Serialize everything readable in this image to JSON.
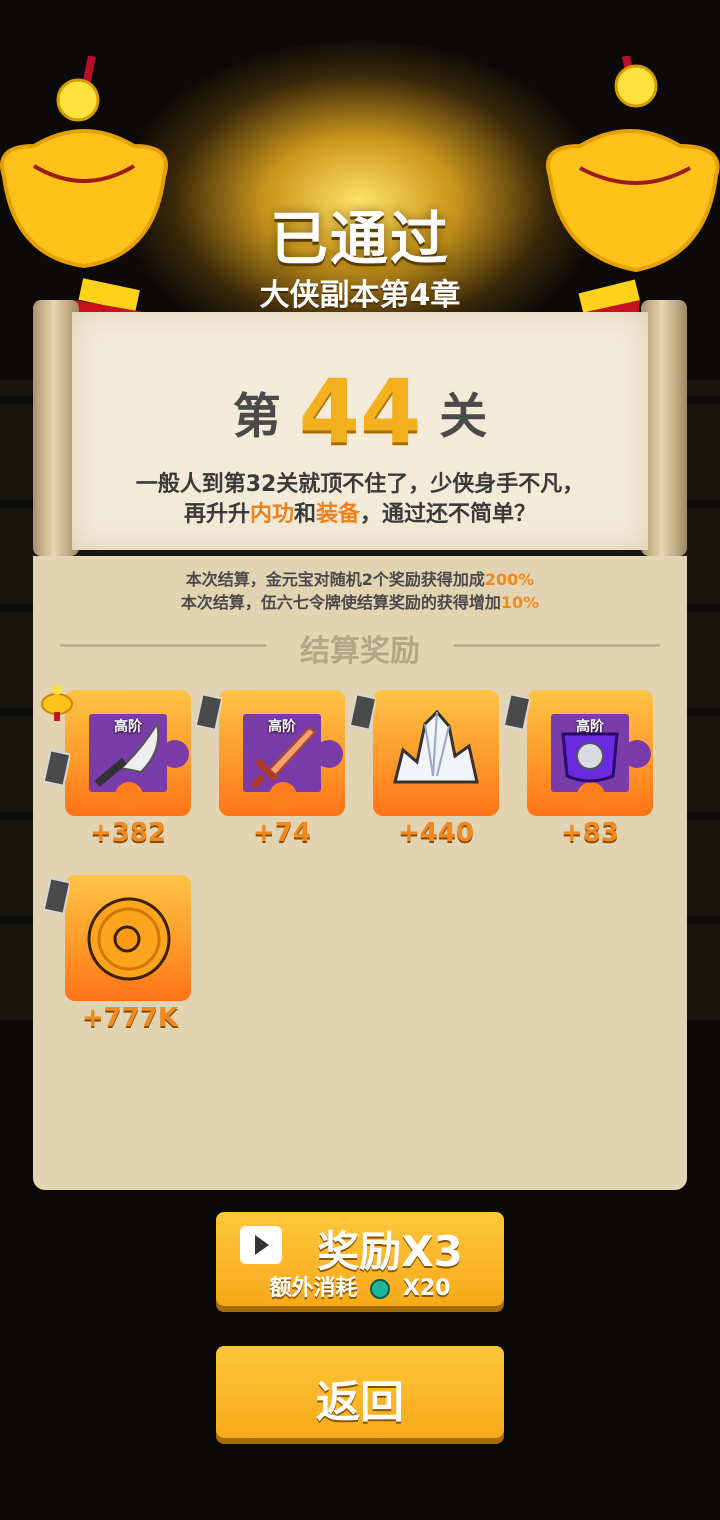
{
  "header": {
    "title": "已通过",
    "chapter": "大侠副本第4章"
  },
  "level": {
    "prefix": "第",
    "number": "44",
    "suffix": "关"
  },
  "description": {
    "line1": "一般人到第32关就顶不住了，少侠身手不凡，",
    "line2_a": "再升升",
    "line2_h1": "内功",
    "line2_b": "和",
    "line2_h2": "装备",
    "line2_c": "，通过还不简单？"
  },
  "bonus_notes": {
    "note1_text": "本次结算，金元宝对随机2个奖励获得加成",
    "note1_percent": "200%",
    "note2_text": "本次结算，伍六七令牌使结算奖励的获得增加",
    "note2_percent": "10%"
  },
  "rewards_section": {
    "title": "结算奖励",
    "items": [
      {
        "icon": "broadsword-fragment-icon",
        "tag": "高阶",
        "amount": "+382"
      },
      {
        "icon": "sword-fragment-icon",
        "tag": "高阶",
        "amount": "+74"
      },
      {
        "icon": "crystal-icon",
        "tag": "",
        "amount": "+440"
      },
      {
        "icon": "armor-fragment-icon",
        "tag": "高阶",
        "amount": "+83"
      },
      {
        "icon": "gold-coin-icon",
        "tag": "",
        "amount": "+777K"
      }
    ]
  },
  "buttons": {
    "reward_label": "奖励X3",
    "extra_cost_label": "额外消耗",
    "cost_amount": "X20",
    "back_label": "返回"
  },
  "colors": {
    "accent_orange": "#f28a1d",
    "button_yellow": "#f6a91a",
    "scroll_paper": "#f4ead8",
    "panel_bg": "#e2d3b2"
  }
}
